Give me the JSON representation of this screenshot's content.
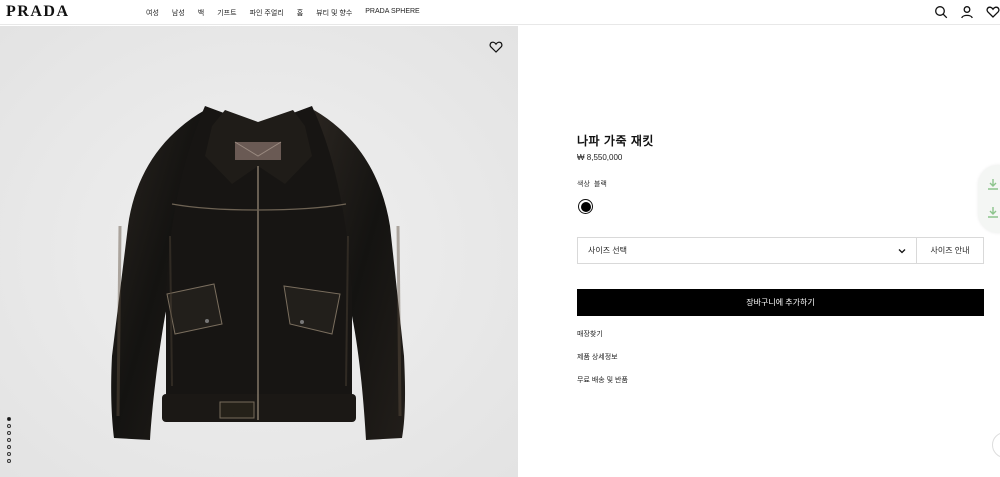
{
  "header": {
    "logo": "PRADA",
    "nav": [
      "여성",
      "남성",
      "백",
      "기프트",
      "파인 주얼리",
      "홈",
      "뷰티 및 향수",
      "PRADA SPHERE"
    ],
    "icons": [
      "search-icon",
      "account-icon",
      "wishlist-icon"
    ]
  },
  "gallery": {
    "image_alt": "black distressed nappa leather jacket",
    "dot_count": 7,
    "active_dot": 0
  },
  "product": {
    "name": "나파 가죽 재킷",
    "price": "₩ 8,550,000",
    "color_label": "색상",
    "color_value": "블랙",
    "swatch_color": "#000000",
    "size_placeholder": "사이즈 선택",
    "size_guide": "사이즈 안내",
    "add_to_cart": "장바구니에 추가하기",
    "links": [
      "매장찾기",
      "제품 상세정보",
      "무료 배송 및 반품"
    ]
  },
  "colors": {
    "accent": "#000000",
    "gallery_bg": "#ebebeb",
    "widget_icon": "#8cc48c"
  }
}
